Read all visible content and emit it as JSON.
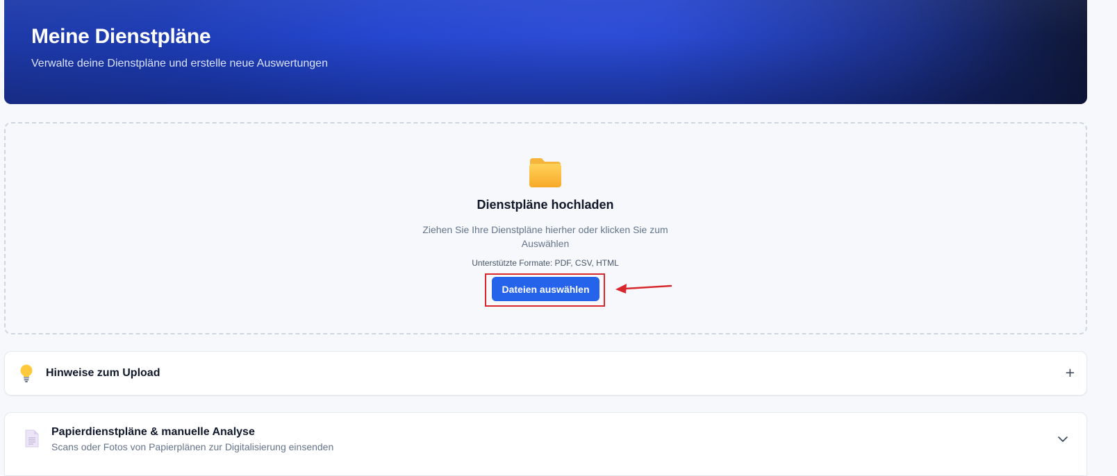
{
  "header": {
    "title": "Meine Dienstpläne",
    "subtitle": "Verwalte deine Dienstpläne und erstelle neue Auswertungen"
  },
  "upload": {
    "icon": "folder-icon",
    "title": "Dienstpläne hochladen",
    "description": "Ziehen Sie Ihre Dienstpläne hierher oder klicken Sie zum Auswählen",
    "formats": "Unterstützte Formate: PDF, CSV, HTML",
    "button_label": "Dateien auswählen",
    "highlight_color": "#d7262c",
    "button_color": "#2563eb"
  },
  "hints_section": {
    "icon": "lightbulb-icon",
    "title": "Hinweise zum Upload",
    "toggle_symbol": "+"
  },
  "paper_section": {
    "icon": "document-icon",
    "title": "Papierdienstpläne & manuelle Analyse",
    "subtitle": "Scans oder Fotos von Papierplänen zur Digitalisierung einsenden",
    "toggle_icon": "chevron-down-icon"
  }
}
